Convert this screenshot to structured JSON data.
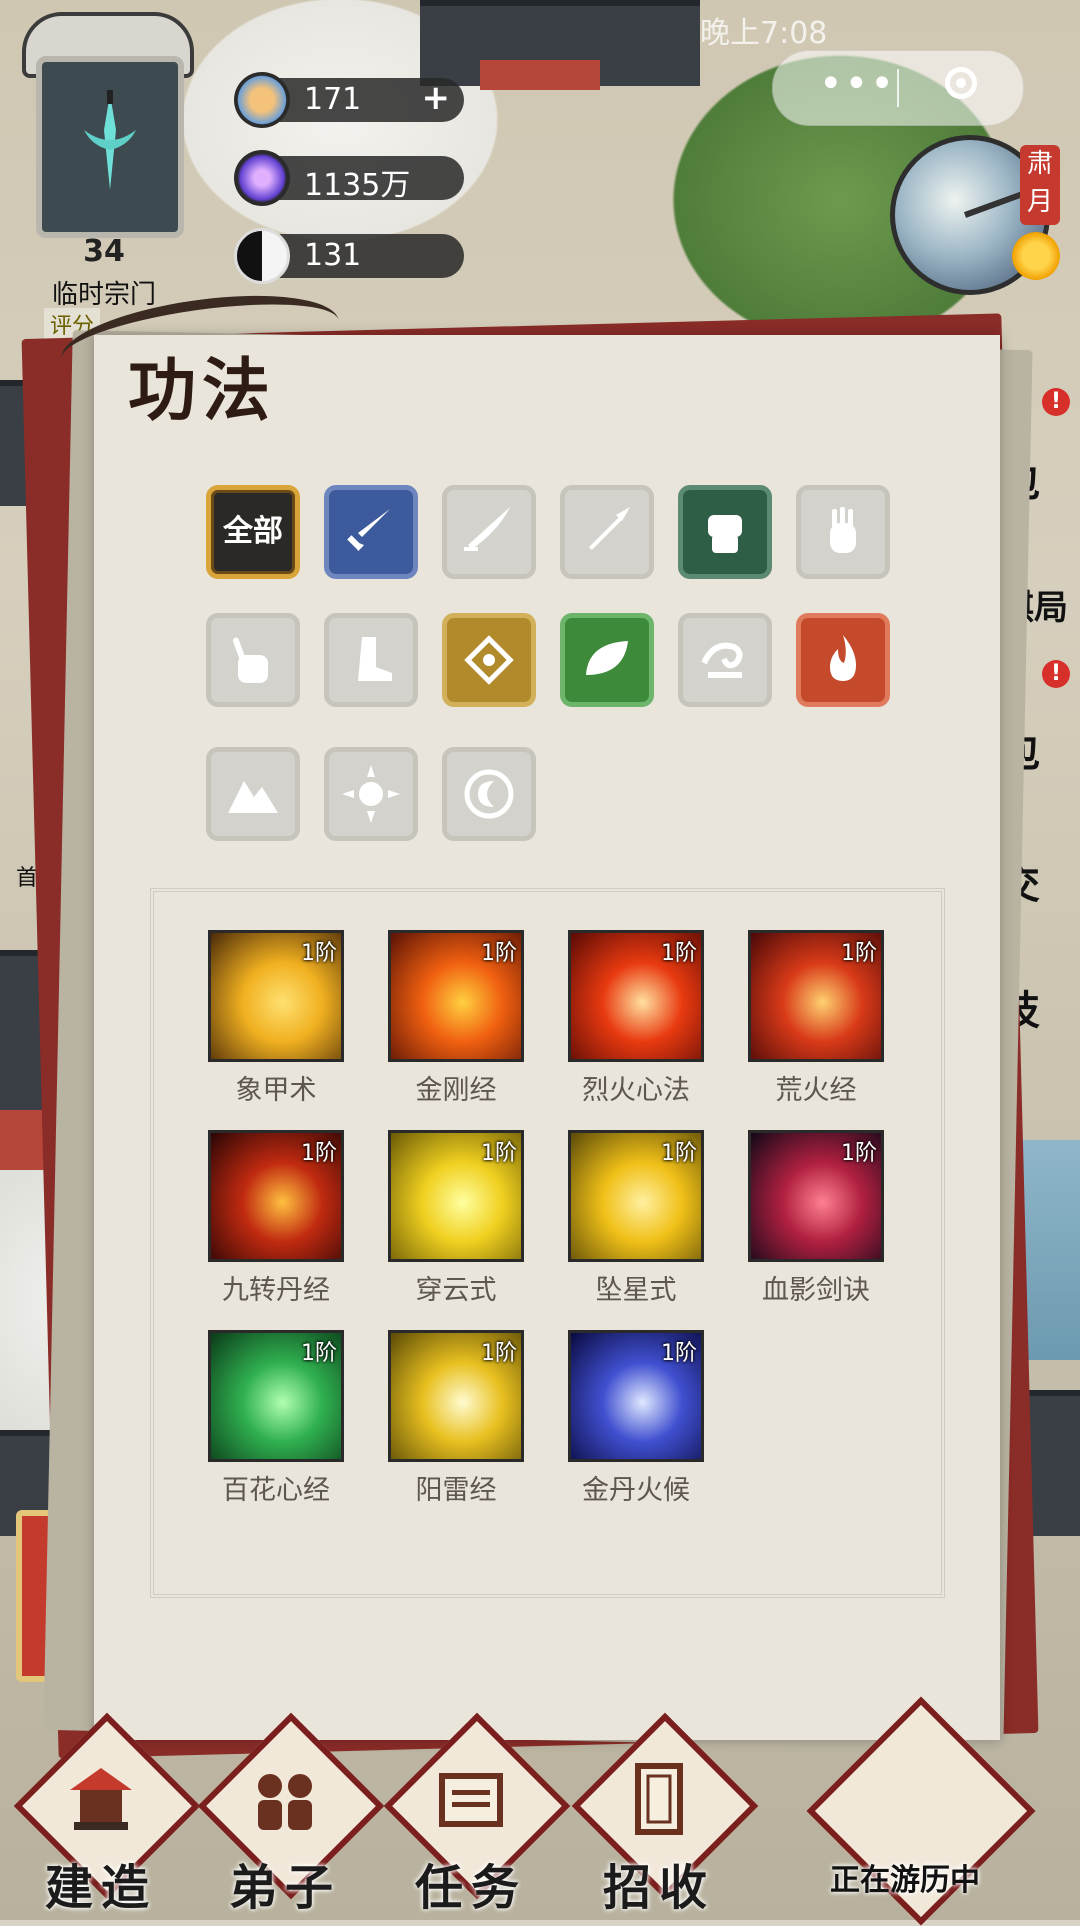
{
  "hud": {
    "sect_level": "34",
    "sect_name": "临时宗门",
    "sect_score_label": "评分",
    "resources": [
      {
        "icon": "spirit-stone-icon",
        "value": "171",
        "plus": "+"
      },
      {
        "icon": "crystal-icon",
        "value": "1135万"
      },
      {
        "icon": "yin-yang-icon",
        "value": "131"
      }
    ],
    "status_time": "晚上7:08",
    "season": "肃月"
  },
  "side_buttons": [
    "包",
    "棋局",
    "包",
    "交",
    "技"
  ],
  "left_items": {
    "first_login": "首次"
  },
  "panel": {
    "title": "功法",
    "filters": [
      {
        "name": "all",
        "label": "全部",
        "active": true
      },
      {
        "name": "sword",
        "color": "#3d5a9c",
        "active": true
      },
      {
        "name": "blade",
        "active": false
      },
      {
        "name": "spear",
        "active": false
      },
      {
        "name": "fist",
        "color": "#2f5e47",
        "active": true
      },
      {
        "name": "palm",
        "active": false
      },
      {
        "name": "finger",
        "active": false
      },
      {
        "name": "boot",
        "active": false
      },
      {
        "name": "talisman",
        "color": "#b08a2b",
        "active": true
      },
      {
        "name": "leaf",
        "color": "#3e8a3b",
        "active": true
      },
      {
        "name": "wind",
        "active": false
      },
      {
        "name": "fire",
        "color": "#c54a2c",
        "active": true
      },
      {
        "name": "mountain",
        "active": false
      },
      {
        "name": "sun",
        "active": false
      },
      {
        "name": "moon",
        "active": false
      }
    ],
    "skills": [
      {
        "name": "象甲术",
        "tier": "1阶",
        "colors": [
          "#4a2a08",
          "#f0b020",
          "#ffe070"
        ]
      },
      {
        "name": "金刚经",
        "tier": "1阶",
        "colors": [
          "#5a1205",
          "#f06010",
          "#ffd040"
        ]
      },
      {
        "name": "烈火心法",
        "tier": "1阶",
        "colors": [
          "#5a0a05",
          "#e83a10",
          "#ffe0a0"
        ]
      },
      {
        "name": "荒火经",
        "tier": "1阶",
        "colors": [
          "#4a0808",
          "#d83a18",
          "#ffd070"
        ]
      },
      {
        "name": "九转丹经",
        "tier": "1阶",
        "colors": [
          "#2a0505",
          "#c02a10",
          "#ffc040"
        ]
      },
      {
        "name": "穿云式",
        "tier": "1阶",
        "colors": [
          "#6a5a05",
          "#f0d020",
          "#ffffa0"
        ]
      },
      {
        "name": "坠星式",
        "tier": "1阶",
        "colors": [
          "#5a4a08",
          "#f0c018",
          "#fff0a0"
        ]
      },
      {
        "name": "血影剑诀",
        "tier": "1阶",
        "colors": [
          "#120818",
          "#b02040",
          "#ff8090"
        ]
      },
      {
        "name": "百花心经",
        "tier": "1阶",
        "colors": [
          "#0a3a18",
          "#30b050",
          "#b0ffb0"
        ]
      },
      {
        "name": "阳雷经",
        "tier": "1阶",
        "colors": [
          "#5a4a05",
          "#e8c020",
          "#fffbd0"
        ]
      },
      {
        "name": "金丹火候",
        "tier": "1阶",
        "colors": [
          "#0a0a40",
          "#4050d0",
          "#e0e8ff"
        ]
      }
    ]
  },
  "bottom_nav": [
    {
      "label": "建造",
      "icon": "pavilion-icon"
    },
    {
      "label": "弟子",
      "icon": "disciples-icon"
    },
    {
      "label": "任务",
      "icon": "scroll-icon"
    },
    {
      "label": "招收",
      "icon": "invitation-icon"
    }
  ],
  "travel": {
    "label": "正在游历中"
  }
}
